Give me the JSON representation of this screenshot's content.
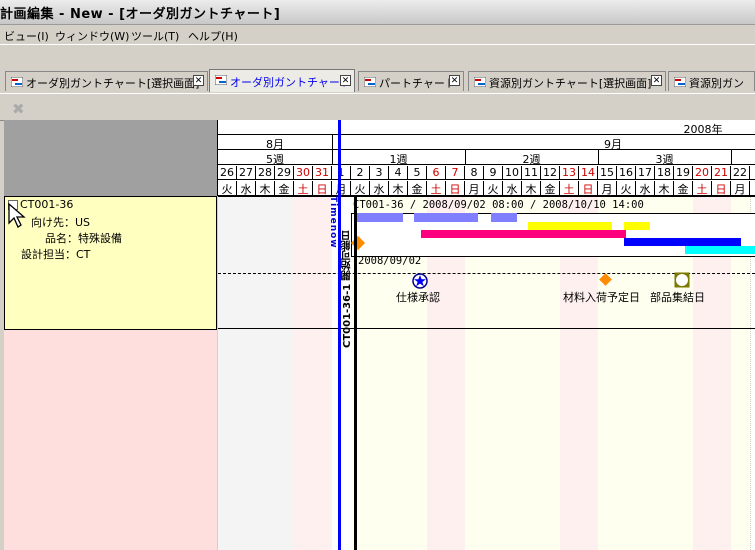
{
  "window": {
    "title": "計画編集 - New - [オーダ別ガントチャート]"
  },
  "menu": [
    "ビュー(I)",
    "ウィンドウ(W)",
    "ツール(T)",
    "ヘルプ(H)"
  ],
  "tabs": [
    {
      "label": "オーダ別ガントチャート[選択画面]",
      "active": false
    },
    {
      "label": "オーダ別ガントチャート",
      "active": true
    },
    {
      "label": "パートチャート",
      "active": false
    },
    {
      "label": "資源別ガントチャート[選択画面]",
      "active": false
    },
    {
      "label": "資源別ガン",
      "active": false
    }
  ],
  "order": {
    "id": "CT001-36",
    "destination": "向け先：US",
    "product": "品名：特殊設備",
    "designer": "設計担当：CT"
  },
  "timeline": {
    "year": "2008年",
    "months": [
      "8月",
      "9月"
    ],
    "weeks": [
      "5週",
      "1週",
      "2週",
      "3週"
    ],
    "days": [
      "26",
      "27",
      "28",
      "29",
      "30",
      "31",
      "1",
      "2",
      "3",
      "4",
      "5",
      "6",
      "7",
      "8",
      "9",
      "10",
      "11",
      "12",
      "13",
      "14",
      "15",
      "16",
      "17",
      "18",
      "19",
      "20",
      "21",
      "22"
    ],
    "weekdays": [
      "火",
      "水",
      "木",
      "金",
      "土",
      "日",
      "月",
      "火",
      "水",
      "木",
      "金",
      "土",
      "日",
      "月",
      "火",
      "水",
      "木",
      "金",
      "土",
      "日",
      "月",
      "火",
      "水",
      "木",
      "金",
      "土",
      "日",
      "月"
    ],
    "holiday_color": "#d00000"
  },
  "gantt": {
    "now_label": "Timenow",
    "side_label": "CT001-36-1 開始可能日",
    "task_label": "CT001-36 / 2008/09/02 08:00 / 2008/10/10 14:00",
    "start_date": "2008/09/02",
    "milestones": [
      "仕様承認",
      "材料入荷予定日",
      "部品集結日"
    ]
  },
  "colors": {
    "now_line": "#0000ff",
    "bar_lavender": "#7f7fff",
    "bar_magenta": "#ff007f",
    "bar_yellow": "#ffff00",
    "bar_blue": "#0000ff",
    "bar_cyan": "#00ffff",
    "milestone_orange": "#ff8c00"
  }
}
